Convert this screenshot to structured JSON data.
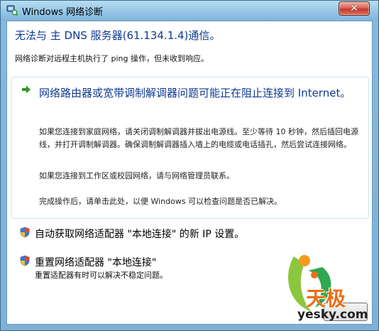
{
  "window": {
    "title": "Windows 网络诊断",
    "close_symbol": "✕"
  },
  "content": {
    "heading": "无法与 主 DNS 服务器(61.134.1.4)通信。",
    "subtext": "网络诊断对远程主机执行了 ping 操作，但未收到响应。",
    "primary_option": {
      "title": "网络路由器或宽带调制解调器问题可能正在阻止连接到 Internet。",
      "detail_1": "如果您连接到家庭网络，请关闭调制解调器并拔出电源线。至少等待 10 秒钟，然后插回电源线，并打开调制解调器。确保调制解调器插入墙上的电缆或电话插孔，然后尝试连接网络。",
      "detail_2": "如果您连接到工作区或校园网络，请与网络管理员联系。",
      "detail_3": "完成操作后，请单击此处，以便 Windows 可以检查问题是否已解决。"
    },
    "option_2": {
      "label": "自动获取网络适配器 \"本地连接\" 的新 IP 设置。"
    },
    "option_3": {
      "label": "重置网络适配器 \"本地连接\"",
      "description": "重置适配器有时可以解决不稳定问题。"
    }
  },
  "watermark": {
    "brand": "天极",
    "url": "yesky.com"
  },
  "icons": {
    "arrow": "green-arrow-icon",
    "shield": "uac-shield-icon"
  },
  "colors": {
    "heading_blue": "#0f3a8f",
    "arrow_green": "#2d9a1f",
    "box_border": "#c6e7f4"
  }
}
